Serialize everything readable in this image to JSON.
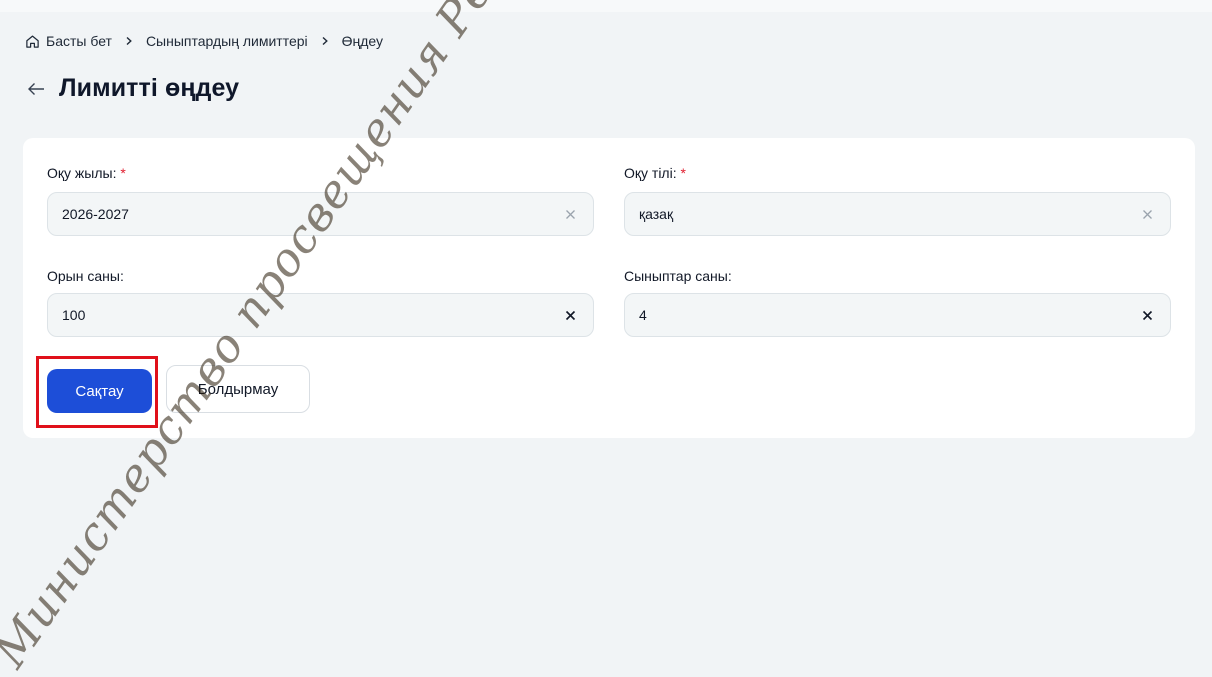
{
  "breadcrumb": {
    "home": "Басты бет",
    "item2": "Сыныптардың лимиттері",
    "current": "Өңдеу"
  },
  "page": {
    "title": "Лимитті өңдеу"
  },
  "form": {
    "academic_year": {
      "label": "Оқу жылы:",
      "required_mark": "*",
      "value": "2026-2027"
    },
    "language": {
      "label": "Оқу тілі:",
      "required_mark": "*",
      "value": "қазақ"
    },
    "seats": {
      "label": "Орын саны:",
      "value": "100"
    },
    "classes": {
      "label": "Сыныптар саны:",
      "value": "4"
    }
  },
  "actions": {
    "save": "Сақтау",
    "cancel": "Болдырмау"
  },
  "watermark": {
    "text": "Министерство просвещения Республики"
  },
  "colors": {
    "primary": "#1d4ed8",
    "required": "#e11d2e",
    "highlight": "#e0101a",
    "background": "#f1f4f6"
  },
  "icons": {
    "home": "home-icon",
    "separator": "chevron-right-icon",
    "back": "arrow-left-icon",
    "clear": "close-icon"
  }
}
